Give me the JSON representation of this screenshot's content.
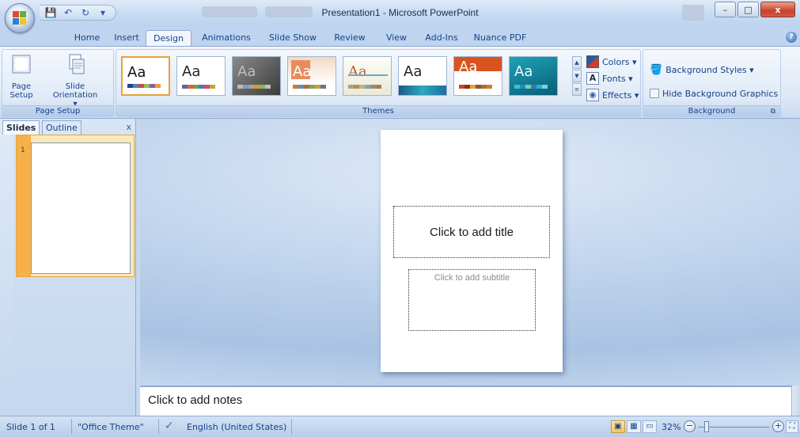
{
  "window": {
    "title": "Presentation1 - Microsoft PowerPoint",
    "minimize": "–",
    "maximize": "□",
    "close": "x"
  },
  "quick_access": {
    "save": "💾",
    "undo": "↶",
    "redo": "↻",
    "customize": "▾"
  },
  "tabs": [
    "Home",
    "Insert",
    "Design",
    "Animations",
    "Slide Show",
    "Review",
    "View",
    "Add-Ins",
    "Nuance PDF"
  ],
  "active_tab": "Design",
  "help": "?",
  "ribbon": {
    "page_setup": {
      "label": "Page Setup",
      "page_setup_btn": "Page Setup",
      "slide_orientation_btn": "Slide Orientation ▾"
    },
    "themes": {
      "label": "Themes",
      "thumb_text": "Aa"
    },
    "theme_options": {
      "colors": "Colors ▾",
      "fonts": "Fonts ▾",
      "effects": "Effects ▾"
    },
    "background": {
      "label": "Background",
      "background_styles": "Background Styles ▾",
      "hide_graphics": "Hide Background Graphics"
    }
  },
  "slides_pane": {
    "tab_slides": "Slides",
    "tab_outline": "Outline",
    "close": "x",
    "slide_number": "1"
  },
  "slide": {
    "title_placeholder": "Click to add title",
    "subtitle_placeholder": "Click to add subtitle"
  },
  "notes": {
    "placeholder": "Click to add notes"
  },
  "status": {
    "slide_count": "Slide 1 of 1",
    "theme": "\"Office Theme\"",
    "language": "English (United States)",
    "zoom": "32%",
    "zoom_out": "−",
    "zoom_in": "+"
  },
  "colors": {
    "accent": "#15428b",
    "selected_orange": "#f8b048"
  }
}
